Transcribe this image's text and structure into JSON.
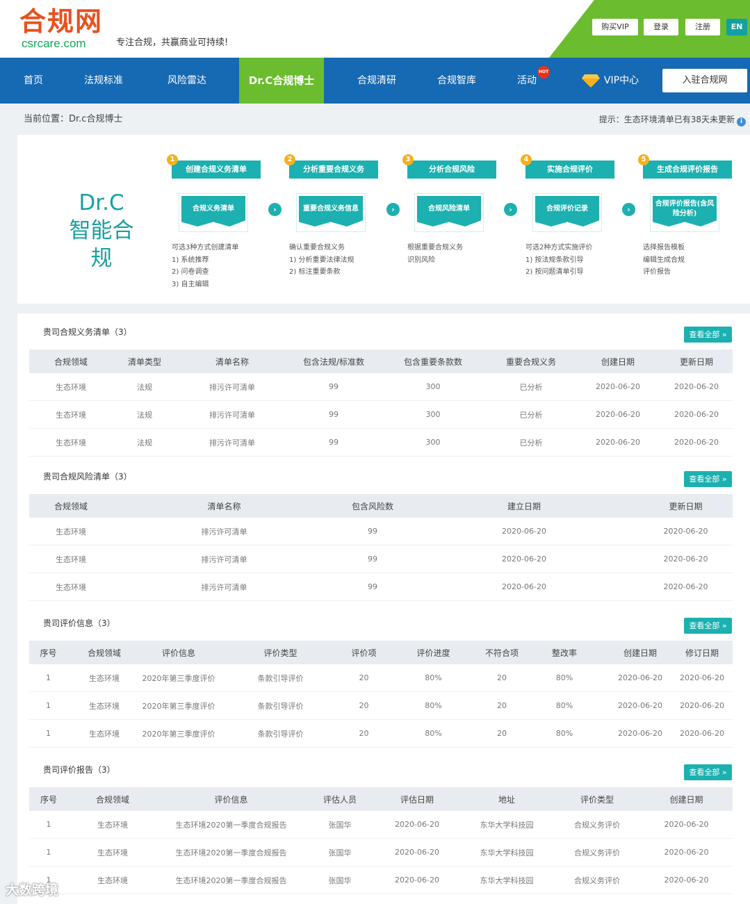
{
  "header": {
    "logo_cn": "合规网",
    "logo_en": "csrcare.com",
    "slogan": "专注合规，共赢商业可持续!",
    "buy_vip": "购买VIP",
    "login": "登录",
    "register": "注册",
    "lang": "EN"
  },
  "nav": {
    "items": [
      "首页",
      "法规标准",
      "风险雷达",
      "Dr.C合规博士",
      "合规清研",
      "合规智库",
      "活动",
      "VIP中心"
    ],
    "hot_badge": "HOT",
    "join": "入驻合规网"
  },
  "breadcrumb": "当前位置：Dr.c合规博士",
  "tip": "提示：生态环境清单已有38天未更新",
  "flow": {
    "title_line1": "Dr.C",
    "title_line2": "智能合规",
    "steps": [
      {
        "num": "1",
        "title": "创建合规义务清单",
        "doc": "合规义务清单",
        "desc": [
          "可选3种方式创建清单",
          "1) 系统推荐",
          "2) 问卷调查",
          "3) 自主编辑"
        ]
      },
      {
        "num": "2",
        "title": "分析重要合规义务",
        "doc": "重要合规义务信息",
        "desc": [
          "确认重要合规义务",
          "1) 分析重要法律法规",
          "2) 标注重要条款"
        ]
      },
      {
        "num": "3",
        "title": "分析合规风险",
        "doc": "合规风险清单",
        "desc": [
          "根据重要合规义务",
          "识别风险"
        ]
      },
      {
        "num": "4",
        "title": "实施合规评价",
        "doc": "合规评价记录",
        "desc": [
          "可选2种方式实施评价",
          "1) 按法规条款引导",
          "2) 按问题清单引导"
        ]
      },
      {
        "num": "5",
        "title": "生成合规评价报告",
        "doc": "合规评价报告(含风险分析)",
        "desc": [
          "选择报告模板",
          "编辑生成合规",
          "评价报告"
        ]
      }
    ]
  },
  "sections": {
    "view_all": "查看全部 »",
    "obligations": {
      "title": "贵司合规义务清单（3）",
      "headers": [
        "合规领域",
        "清单类型",
        "清单名称",
        "包含法规/标准数",
        "包含重要条款数",
        "重要合规义务",
        "创建日期",
        "更新日期"
      ],
      "rows": [
        [
          "生态环境",
          "法规",
          "排污许可清单",
          "99",
          "300",
          "已分析",
          "2020-06-20",
          "2020-06-20"
        ],
        [
          "生态环境",
          "法规",
          "排污许可清单",
          "99",
          "300",
          "已分析",
          "2020-06-20",
          "2020-06-20"
        ],
        [
          "生态环境",
          "法规",
          "排污许可清单",
          "99",
          "300",
          "已分析",
          "2020-06-20",
          "2020-06-20"
        ]
      ]
    },
    "risks": {
      "title": "贵司合规风险清单（3）",
      "headers": [
        "合规领域",
        "清单名称",
        "包含风险数",
        "建立日期",
        "更新日期"
      ],
      "rows": [
        [
          "生态环境",
          "排污许可清单",
          "99",
          "2020-06-20",
          "2020-06-20"
        ],
        [
          "生态环境",
          "排污许可清单",
          "99",
          "2020-06-20",
          "2020-06-20"
        ],
        [
          "生态环境",
          "排污许可清单",
          "99",
          "2020-06-20",
          "2020-06-20"
        ]
      ]
    },
    "evaluations": {
      "title": "贵司评价信息（3）",
      "headers": [
        "序号",
        "合规领域",
        "评价信息",
        "评价类型",
        "评价项",
        "评价进度",
        "不符合项",
        "整改率",
        "创建日期",
        "修订日期"
      ],
      "rows": [
        [
          "1",
          "生态环境",
          "2020年第三季度评价",
          "条款引导评价",
          "20",
          "80%",
          "20",
          "80%",
          "2020-06-20",
          "2020-06-20"
        ],
        [
          "1",
          "生态环境",
          "2020年第三季度评价",
          "条款引导评价",
          "20",
          "80%",
          "20",
          "80%",
          "2020-06-20",
          "2020-06-20"
        ],
        [
          "1",
          "生态环境",
          "2020年第三季度评价",
          "条款引导评价",
          "20",
          "80%",
          "20",
          "80%",
          "2020-06-20",
          "2020-06-20"
        ]
      ]
    },
    "reports": {
      "title": "贵司评价报告（3）",
      "headers": [
        "序号",
        "合规领域",
        "评价信息",
        "评估人员",
        "评估日期",
        "地址",
        "评价类型",
        "创建日期"
      ],
      "rows": [
        [
          "1",
          "生态环境",
          "生态环境2020第一季度合规报告",
          "张国华",
          "2020-06-20",
          "东华大学科技园",
          "合规义务评价",
          "2020-06-20"
        ],
        [
          "1",
          "生态环境",
          "生态环境2020第一季度合规报告",
          "张国华",
          "2020-06-20",
          "东华大学科技园",
          "合规义务评价",
          "2020-06-20"
        ],
        [
          "1",
          "生态环境",
          "生态环境2020第一季度合规报告",
          "张国华",
          "2020-06-20",
          "东华大学科技园",
          "合规义务评价",
          "2020-06-20"
        ]
      ]
    }
  },
  "watermark": "大数跨境",
  "colors": {
    "nav_blue": "#1669b3",
    "brand_green": "#6bbd2f",
    "teal": "#1cb0b0",
    "logo_orange": "#e8501c"
  }
}
